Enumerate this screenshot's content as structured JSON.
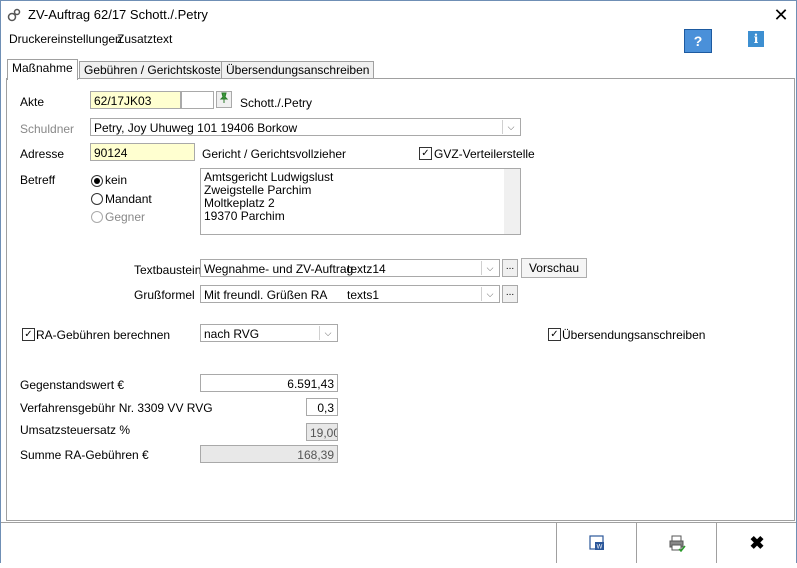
{
  "window": {
    "title": "ZV-Auftrag  62/17 Schott./.Petry"
  },
  "menu": {
    "item1": "Druckereinstellungen",
    "item2": "Zusatztext"
  },
  "tabs": [
    {
      "label": "Maßnahme",
      "active": true
    },
    {
      "label": "Gebühren / Gerichtskosten",
      "active": false
    },
    {
      "label": "Übersendungsanschreiben",
      "active": false
    }
  ],
  "form": {
    "akte_label": "Akte",
    "akte_value": "62/17JK03",
    "akte_extra": "",
    "akte_parties": "Schott./.Petry",
    "schuldner_label": "Schuldner",
    "schuldner_value": "Petry, Joy  Uhuweg 101 19406 Borkow",
    "adresse_label": "Adresse",
    "adresse_value": "90124",
    "adresse_desc": "Gericht / Gerichtsvollzieher",
    "gvz_label": "GVZ-Verteilerstelle",
    "betreff_label": "Betreff",
    "radio_kein": "kein",
    "radio_mandant": "Mandant",
    "radio_gegner": "Gegner",
    "address_lines": [
      "Amtsgericht Ludwigslust",
      "Zweigstelle Parchim",
      "Moltkeplatz 2",
      "19370 Parchim"
    ],
    "textbaustein_label": "Textbaustein",
    "textbaustein_value": "Wegnahme- und ZV-Auftrag",
    "textbaustein_code": "textz14",
    "vorschau_label": "Vorschau",
    "grussformel_label": "Grußformel",
    "grussformel_value": "Mit freundl. Grüßen RA",
    "grussformel_code": "texts1",
    "ra_gebuehren_label": "RA-Gebühren berechnen",
    "rvg_value": "nach RVG",
    "uebersendung_label": "Übersendungsanschreiben",
    "gegenstandswert_label": "Gegenstandswert €",
    "gegenstandswert_value": "6.591,43",
    "verfahrensgebuehr_label": "Verfahrensgebühr Nr. 3309 VV RVG",
    "verfahrensgebuehr_value": "0,3",
    "ust_label": "Umsatzsteuersatz %",
    "ust_value": "19,00",
    "summe_label": "Summe RA-Gebühren €",
    "summe_value": "168,39",
    "ellipsis": "..."
  },
  "icons": {
    "help": "?",
    "info": "i",
    "close": "✕",
    "cancel": "✖"
  }
}
